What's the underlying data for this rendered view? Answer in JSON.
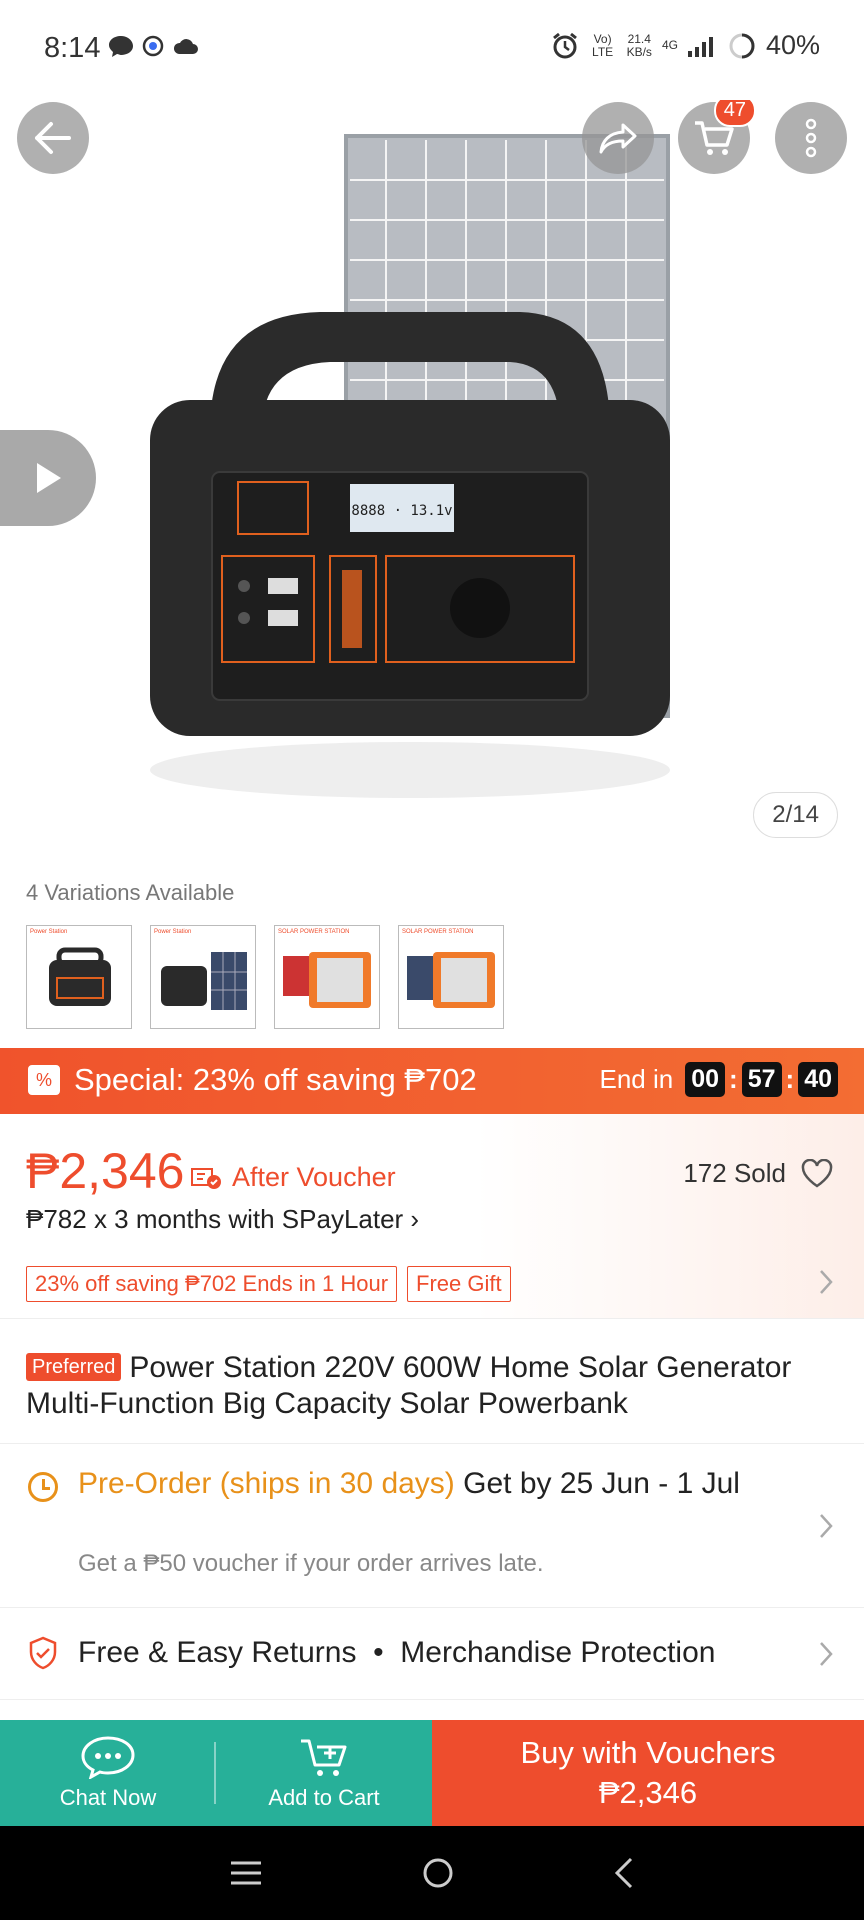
{
  "status_bar": {
    "time": "8:14",
    "lte_label": "Vo) LTE",
    "speed": "21.4",
    "speed_unit": "KB/s",
    "network": "4G",
    "battery": "40%"
  },
  "header": {
    "cart_count": "47"
  },
  "gallery": {
    "page_indicator": "2/14"
  },
  "variations": {
    "label": "4 Variations Available",
    "items": [
      {
        "caption": "Power Station"
      },
      {
        "caption": "Power Station"
      },
      {
        "caption": "SOLAR POWER STATION"
      },
      {
        "caption": "SOLAR POWER STATION"
      }
    ]
  },
  "special": {
    "text": "Special: 23% off saving ₱702",
    "end_label": "End in",
    "hours": "00",
    "minutes": "57",
    "seconds": "40"
  },
  "price": {
    "amount": "₱2,346",
    "after_voucher": "After Voucher",
    "sold": "172 Sold",
    "installment": "₱782 x 3 months with SPayLater ›",
    "tags": [
      "23% off saving ₱702 Ends in 1 Hour",
      "Free Gift"
    ]
  },
  "product": {
    "badge": "Preferred",
    "title": "Power Station 220V 600W Home Solar Generator Multi-Function Big Capacity Solar Powerbank"
  },
  "shipping": {
    "preorder": "Pre-Order (ships in 30 days)",
    "get_by": " Get by 25 Jun - 1 Jul",
    "voucher_note": "Get a ₱50 voucher if your order arrives late."
  },
  "returns": {
    "text": "Free & Easy Returns  •  Merchandise Protection"
  },
  "bottom_bar": {
    "chat_label": "Chat Now",
    "cart_label": "Add to Cart",
    "buy_label": "Buy with Vouchers",
    "buy_price": "₱2,346"
  },
  "colors": {
    "accent": "#ee4d2d",
    "teal": "#27b099",
    "preorder": "#e8911a"
  }
}
